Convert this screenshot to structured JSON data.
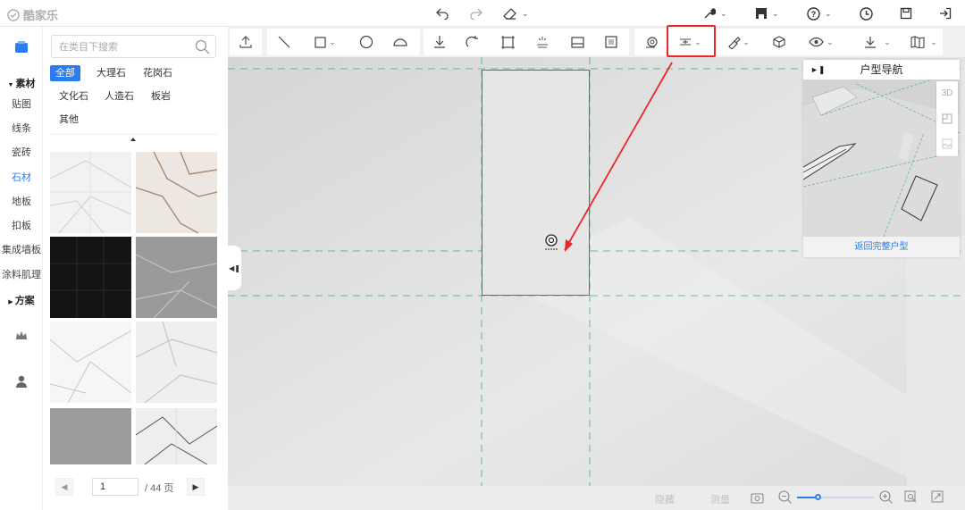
{
  "app": {
    "brand": "酷家乐"
  },
  "titlebar": {
    "icons": [
      "undo-icon",
      "redo-icon",
      "eraser-icon",
      "wrench-icon",
      "save-icon",
      "help-icon",
      "history-icon",
      "floppy-icon",
      "exit-icon"
    ]
  },
  "rail": {
    "section_material": "素材",
    "items": [
      "贴图",
      "线条",
      "瓷砖",
      "石材",
      "地板",
      "扣板",
      "集成墙板",
      "涂料肌理"
    ],
    "active_item": "石材",
    "section_plan": "方案"
  },
  "panel": {
    "search_placeholder": "在类目下搜索",
    "categories": [
      "全部",
      "大理石",
      "花岗石",
      "文化石",
      "人造石",
      "板岩",
      "其他"
    ],
    "active_category": "全部",
    "pager": {
      "current": "1",
      "total_label": "/ 44 页"
    }
  },
  "toolbar": {
    "icons": [
      "upload-icon",
      "line-tool-icon",
      "rectangle-tool-icon",
      "circle-tool-icon",
      "arc-tool-icon",
      "move-icon",
      "rotate-icon",
      "area-icon",
      "light-icon",
      "panel-icon",
      "texture-icon",
      "camera-icon",
      "align-icon",
      "brush-icon",
      "cube-icon",
      "eye-icon",
      "download-icon",
      "map-icon"
    ],
    "highlighted": "align-icon"
  },
  "navigator": {
    "title": "户型导航",
    "view_buttons": [
      "3D",
      "2D",
      "img"
    ],
    "footer": "返回完整户型"
  },
  "statusbar": {
    "label_left": "隐藏",
    "label_right": "测量",
    "zoom_fraction": 0.28
  },
  "colors": {
    "accent": "#2a7cf0",
    "highlight": "#e8282a",
    "guide": "#3bb07a"
  }
}
